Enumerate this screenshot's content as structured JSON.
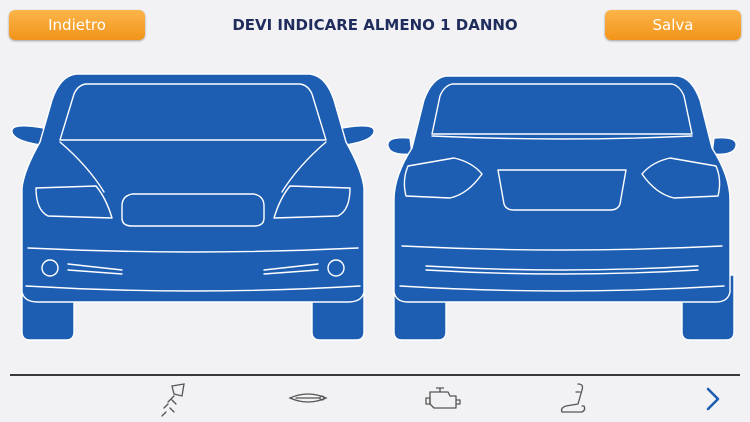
{
  "header": {
    "back_label": "Indietro",
    "title": "DEVI INDICARE ALMENO 1 DANNO",
    "save_label": "Salva"
  },
  "views": [
    {
      "name": "front",
      "icon": "car-front-icon"
    },
    {
      "name": "rear",
      "icon": "car-rear-icon"
    }
  ],
  "toolbar": {
    "items": [
      "glass-damage-icon",
      "door-handle-icon",
      "engine-icon",
      "seat-icon"
    ],
    "next_icon": "chevron-right-icon"
  },
  "colors": {
    "button": "#f7a22c",
    "title": "#1f2c5c",
    "car_fill": "#1d5eb3",
    "toolbar_icon": "#555555",
    "chevron": "#1d5eb3"
  }
}
